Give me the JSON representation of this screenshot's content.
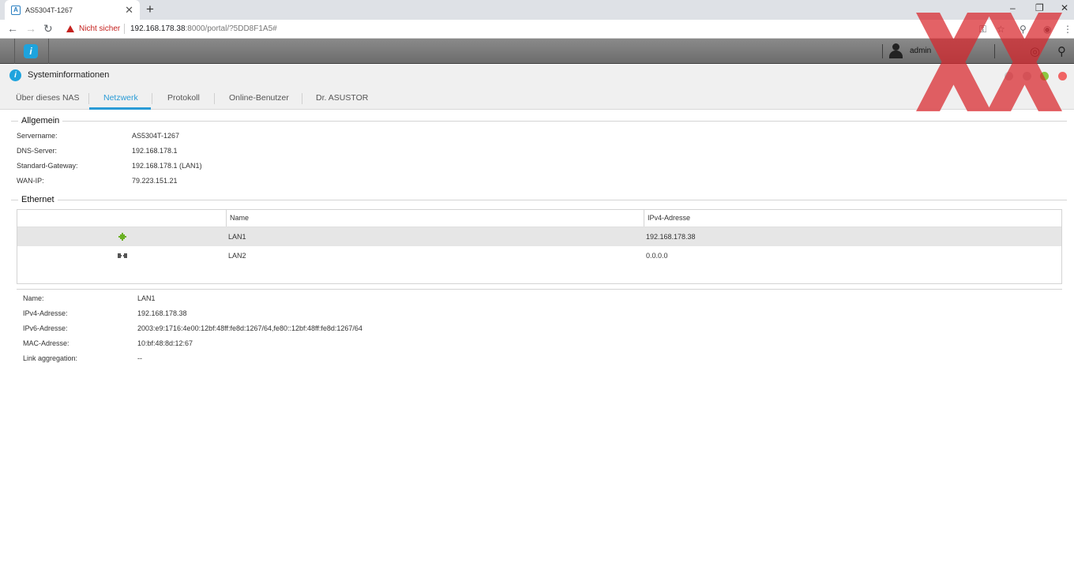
{
  "browser": {
    "tab_title": "AS5304T-1267",
    "tab_favicon": "A",
    "new_tab": "+",
    "win_min": "–",
    "win_restore": "❐",
    "win_close": "✕",
    "back": "←",
    "forward": "→",
    "reload": "↻",
    "security_label": "Nicht sicher",
    "url_host": "192.168.178.38",
    "url_path": ":8000/portal/?5DD8F1A5#",
    "menu": "⋮"
  },
  "adm": {
    "user": "admin",
    "info_glyph": "i"
  },
  "app": {
    "title": "Systeminformationen",
    "icon_glyph": "i",
    "tabs": [
      {
        "label": "Über dieses NAS"
      },
      {
        "label": "Netzwerk"
      },
      {
        "label": "Protokoll"
      },
      {
        "label": "Online-Benutzer"
      },
      {
        "label": "Dr. ASUSTOR"
      }
    ]
  },
  "general": {
    "title": "Allgemein",
    "rows": [
      {
        "label": "Servername:",
        "value": "AS5304T-1267"
      },
      {
        "label": "DNS-Server:",
        "value": "192.168.178.1"
      },
      {
        "label": "Standard-Gateway:",
        "value": "192.168.178.1 (LAN1)"
      },
      {
        "label": "WAN-IP:",
        "value": "79.223.151.21"
      }
    ]
  },
  "ethernet": {
    "title": "Ethernet",
    "columns": [
      "",
      "Name",
      "IPv4-Adresse"
    ],
    "rows": [
      {
        "status": "connected",
        "name": "LAN1",
        "ipv4": "192.168.178.38",
        "color": "#6ab023"
      },
      {
        "status": "disconnected",
        "name": "LAN2",
        "ipv4": "0.0.0.0",
        "color": "#555555"
      }
    ]
  },
  "details": {
    "rows": [
      {
        "label": "Name:",
        "value": "LAN1"
      },
      {
        "label": "IPv4-Adresse:",
        "value": "192.168.178.38"
      },
      {
        "label": "IPv6-Adresse:",
        "value": "2003:e9:1716:4e00:12bf:48ff:fe8d:1267/64,fe80::12bf:48ff:fe8d:1267/64"
      },
      {
        "label": "MAC-Adresse:",
        "value": "10:bf:48:8d:12:67"
      },
      {
        "label": "Link aggregation:",
        "value": "--"
      }
    ]
  },
  "colors": {
    "accent": "#2a9bd6",
    "dot_green": "#8cc63f",
    "dot_red": "#f06464"
  }
}
